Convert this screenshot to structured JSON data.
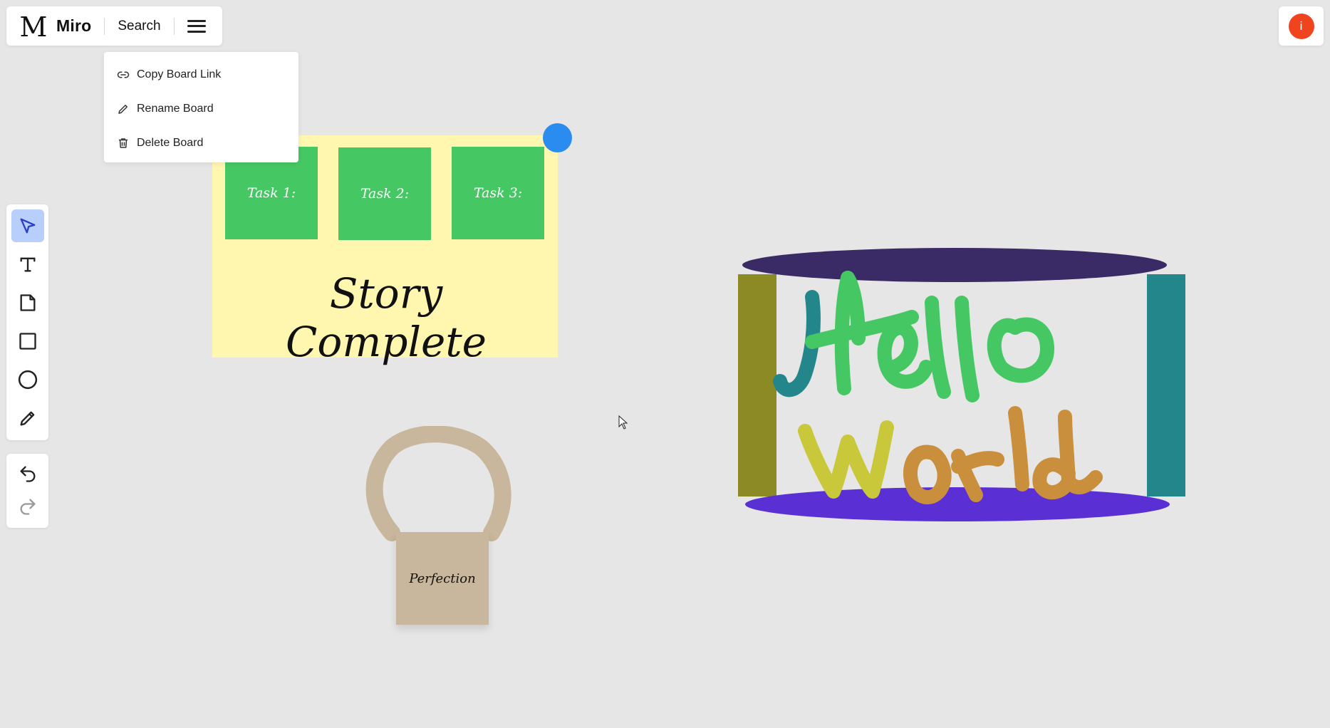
{
  "header": {
    "app_name": "Miro",
    "search_label": "Search"
  },
  "menu": {
    "items": [
      {
        "label": "Copy Board Link",
        "icon": "link-icon"
      },
      {
        "label": "Rename Board",
        "icon": "pencil-icon"
      },
      {
        "label": "Delete Board",
        "icon": "trash-icon"
      }
    ]
  },
  "user": {
    "avatar_initial": "i",
    "avatar_color": "#f0441f"
  },
  "toolbar": {
    "tools": [
      "select-tool",
      "text-tool",
      "sticky-note-tool",
      "rectangle-tool",
      "ellipse-tool",
      "pen-tool"
    ],
    "active_tool": "select-tool",
    "history": [
      "undo",
      "redo"
    ]
  },
  "board": {
    "tasks": [
      "Task 1:",
      "Task 2:",
      "Task 3:"
    ],
    "story_text": "Story Complete",
    "perfection_text": "Perfection",
    "colors": {
      "task_green": "#45c863",
      "story_yellow": "#fff6b0",
      "note_tan": "#c8b79c",
      "selection_handle": "#2b8cf0"
    }
  }
}
